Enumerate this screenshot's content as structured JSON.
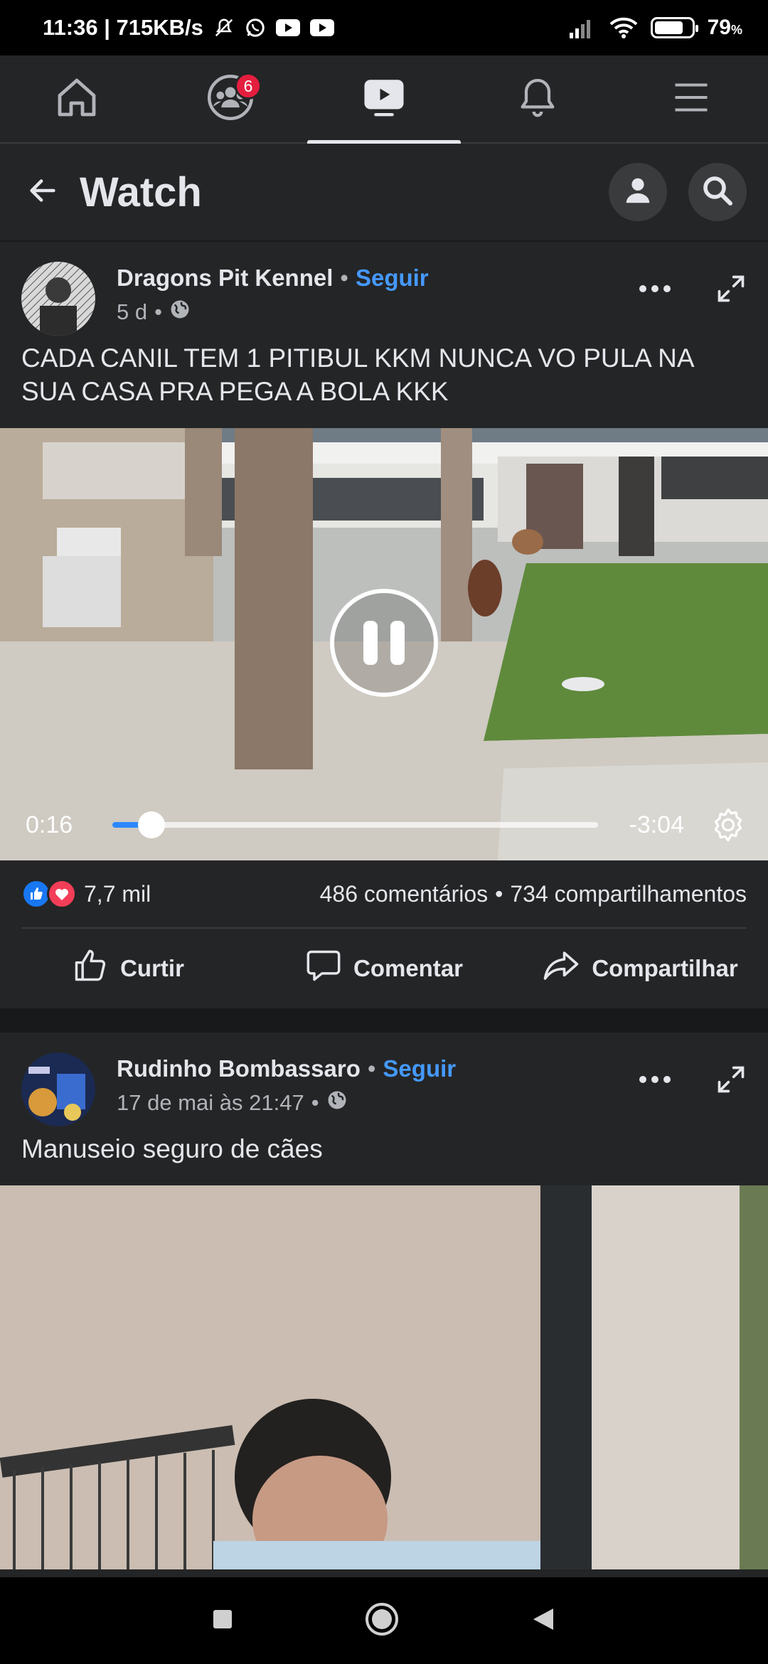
{
  "status_bar": {
    "time_speed": "11:36 | 715KB/s",
    "battery_pct": "79",
    "battery_unit": "%",
    "battery_level": 0.79
  },
  "top_nav": {
    "tabs": [
      {
        "icon": "home-icon"
      },
      {
        "icon": "groups-icon",
        "badge": "6"
      },
      {
        "icon": "watch-icon",
        "active": true
      },
      {
        "icon": "bell-icon"
      },
      {
        "icon": "menu-icon"
      }
    ]
  },
  "header": {
    "title": "Watch"
  },
  "posts": [
    {
      "author": "Dragons Pit Kennel",
      "separator": "•",
      "follow": "Seguir",
      "time": "5 d",
      "text": "CADA CANIL TEM 1 PITIBUL KKM NUNCA VO PULA NA SUA CASA PRA PEGA A BOLA KKK",
      "video": {
        "elapsed": "0:16",
        "remaining": "-3:04",
        "progress": 0.08
      },
      "reactions": "7,7 mil",
      "comments": "486 comentários",
      "shares": "734 compartilhamentos",
      "actions": [
        "Curtir",
        "Comentar",
        "Compartilhar"
      ]
    },
    {
      "author": "Rudinho Bombassaro",
      "separator": "•",
      "follow": "Seguir",
      "time": "17 de mai às 21:47",
      "text": "Manuseio seguro de cães"
    }
  ],
  "colors": {
    "background": "#18191a",
    "surface": "#242526",
    "accent": "#4599ff",
    "badge": "#e41e3f",
    "progress": "#2d88ff"
  }
}
